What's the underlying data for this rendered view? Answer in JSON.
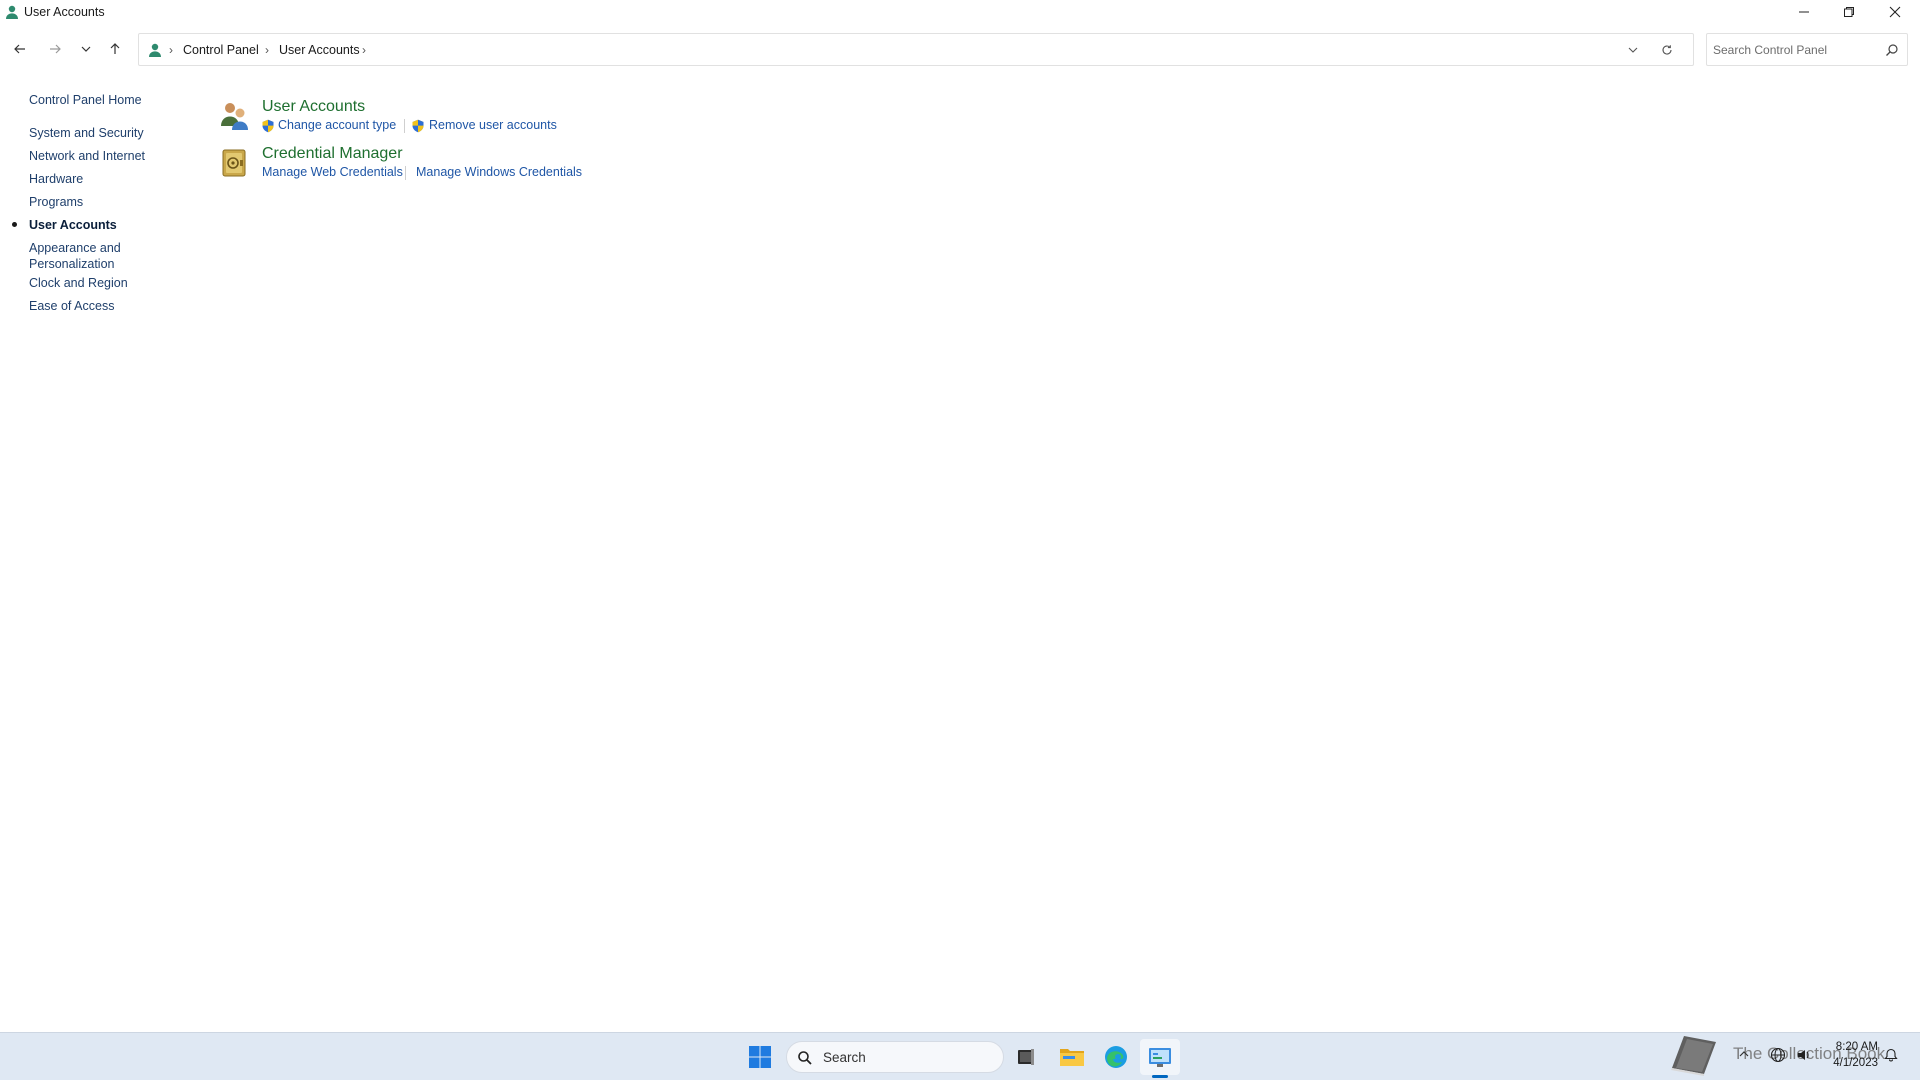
{
  "window": {
    "title": "User Accounts",
    "controls": {
      "minimize": "minimize",
      "maximize": "restore",
      "close": "close"
    }
  },
  "navigation": {
    "back": "back-arrow",
    "forward": "forward-arrow",
    "recent": "chevron-down",
    "up": "up-arrow"
  },
  "address_bar": {
    "location_icon": "user-accounts-icon",
    "breadcrumbs": [
      "Control Panel",
      "User Accounts"
    ]
  },
  "search": {
    "placeholder": "Search Control Panel"
  },
  "left_nav": {
    "home": "Control Panel Home",
    "items": [
      {
        "label": "System and Security",
        "current": false
      },
      {
        "label": "Network and Internet",
        "current": false
      },
      {
        "label": "Hardware",
        "current": false
      },
      {
        "label": "Programs",
        "current": false
      },
      {
        "label": "User Accounts",
        "current": true
      },
      {
        "label": "Appearance and Personalization",
        "current": false
      },
      {
        "label": "Clock and Region",
        "current": false
      },
      {
        "label": "Ease of Access",
        "current": false
      }
    ]
  },
  "categories": [
    {
      "title": "User Accounts",
      "icon": "user-accounts-icon",
      "tasks": [
        {
          "label": "Change account type",
          "shield": true
        },
        {
          "label": "Remove user accounts",
          "shield": true
        }
      ]
    },
    {
      "title": "Credential Manager",
      "icon": "credential-manager-icon",
      "tasks": [
        {
          "label": "Manage Web Credentials",
          "shield": false
        },
        {
          "label": "Manage Windows Credentials",
          "shield": false
        }
      ]
    }
  ],
  "taskbar": {
    "search_label": "Search",
    "apps": [
      "start",
      "task-view",
      "file-explorer",
      "edge",
      "control-panel"
    ],
    "watermark": "The Collection Book",
    "time": "8:20 AM",
    "date": "4/1/2023"
  },
  "colors": {
    "category_title": "#1e6f2f",
    "task_link": "#1f56a6",
    "left_nav_link": "#1f3f6b",
    "taskbar": "#dfe8f3",
    "accent": "#0067c0"
  }
}
